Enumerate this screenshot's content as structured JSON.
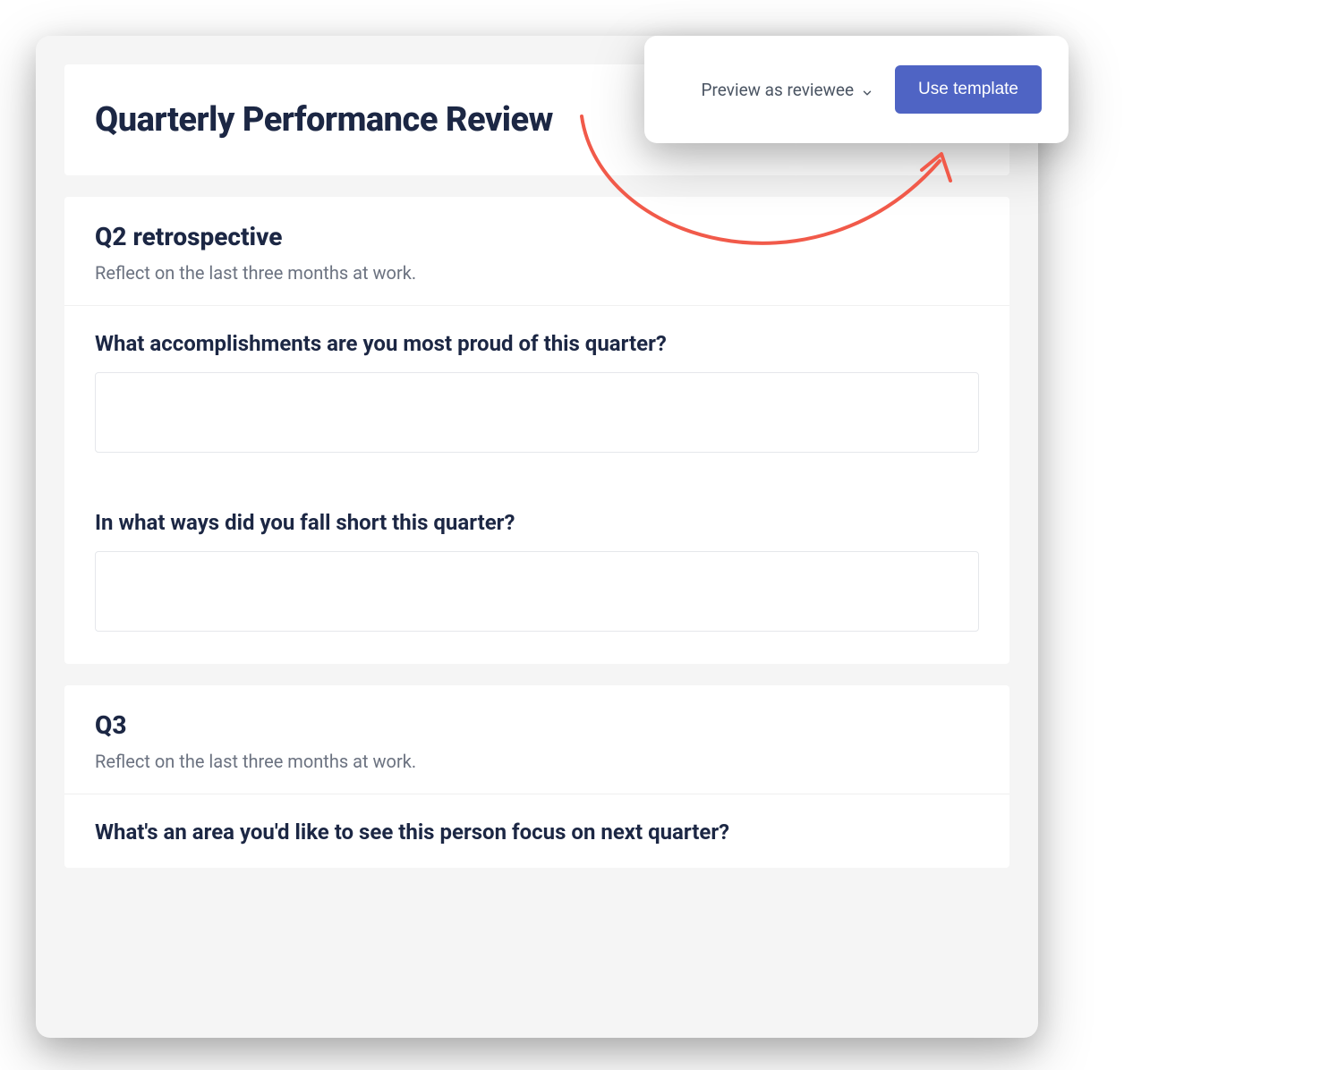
{
  "header": {
    "title": "Quarterly Performance Review"
  },
  "toolbar": {
    "preview_label": "Preview as reviewee",
    "use_template_label": "Use template"
  },
  "sections": [
    {
      "title": "Q2 retrospective",
      "description": "Reflect on the last three months at work.",
      "questions": [
        {
          "label": "What accomplishments are you most proud of this quarter?",
          "value": ""
        },
        {
          "label": "In what ways did you fall short this quarter?",
          "value": ""
        }
      ]
    },
    {
      "title": "Q3",
      "description": "Reflect on the last three months at work.",
      "questions": [
        {
          "label": "What's an area you'd like to see this person focus on next quarter?",
          "value": ""
        }
      ]
    }
  ]
}
